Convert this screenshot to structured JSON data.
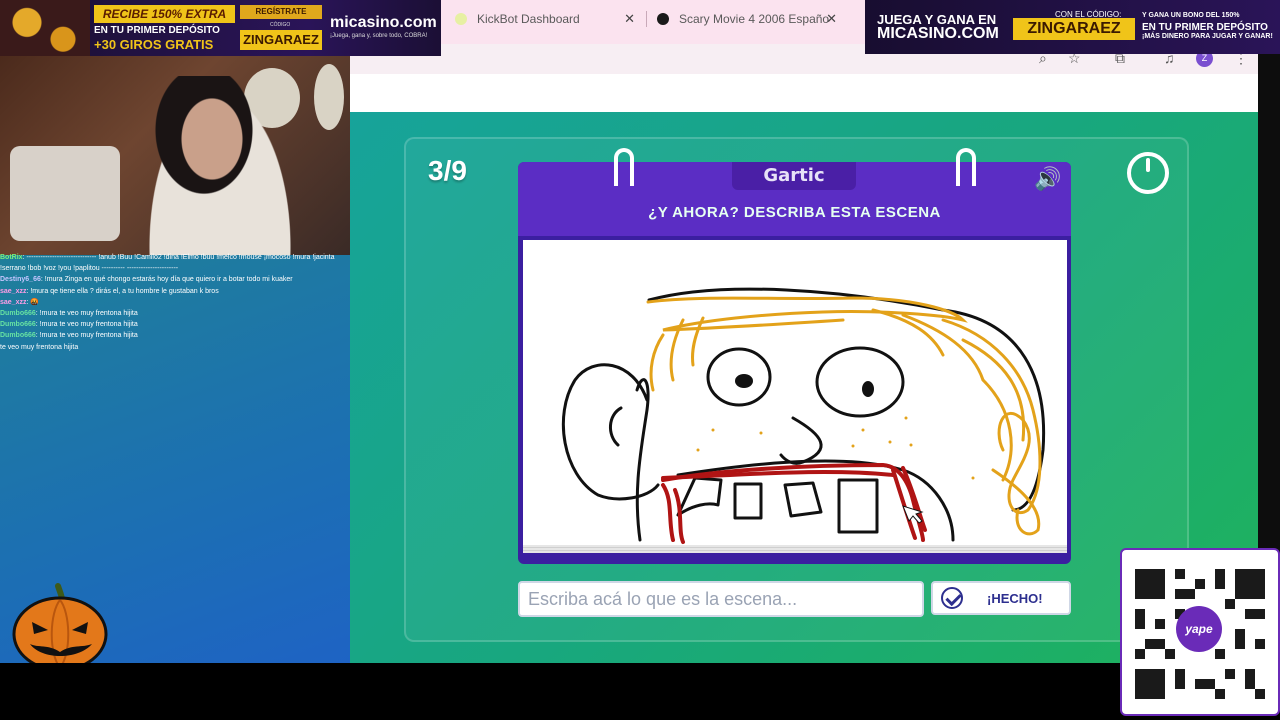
{
  "browser": {
    "tabs": [
      {
        "title": "KickBot Dashboard",
        "fav_color": "#e7f0a3"
      },
      {
        "title": "Scary Movie 4 2006 Españo",
        "fav_color": "#1a1a1a"
      }
    ],
    "profile_initial": "Z"
  },
  "game": {
    "round": "3/9",
    "brand": "Gartic",
    "instruction": "¿Y AHORA? DESCRIBA ESTA ESCENA",
    "input_placeholder": "Escriba acá lo que es la escena...",
    "done_label": "¡HECHO!",
    "colors": {
      "bg": "#17a39a",
      "header": "#5b2dc4",
      "book": "#3b1fa0",
      "instruction": "#e6fff2"
    }
  },
  "ads": {
    "left": {
      "offer_line1": "RECIBE 150% EXTRA",
      "offer_line2": "EN TU PRIMER DEPÓSITO",
      "offer_line3": "+30 GIROS GRATIS",
      "register": "REGÍSTRATE",
      "code_label": "CÓDIGO",
      "code": "ZINGARAEZ",
      "logo": "micasino.com",
      "tagline": "¡Juega, gana y, sobre todo, COBRA!"
    },
    "right": {
      "line1": "JUEGA Y GANA EN",
      "line2": "MICASINO.COM",
      "code_label": "CON EL CÓDIGO:",
      "code": "ZINGARAEZ",
      "line3": "Y GANA UN BONO DEL 150%",
      "line4": "EN TU PRIMER DEPÓSITO",
      "line5": "¡MÁS DINERO PARA JUGAR Y GANAR!"
    }
  },
  "chat": [
    {
      "user": "BotRix",
      "color": "#7cf07c",
      "text": ": ------------------------------ !anub !Buu !Camilo2 !dina !Elmo !buu !melco !mouse ¡mocoso !mura !jacinta !serrano !bob !voz !you !paplitou ---------- ----------------------"
    },
    {
      "user": "Destiny6_66",
      "color": "#c6c6ff",
      "text": ": !mura Zinga en qué chongo estarás hoy día que quiero ir a botar todo mi kuaker"
    },
    {
      "user": "sae_xzz",
      "color": "#ff9de6",
      "text": ": !mura qe tiene ella ? dirás el, a tu hombre le gustaban k bros"
    },
    {
      "user": "sae_xzz",
      "color": "#ff9de6",
      "text": ": 🤬"
    },
    {
      "user": "Dumbo666",
      "color": "#66e2a2",
      "text": ": !mura te veo muy frentona hijita"
    },
    {
      "user": "Dumbo666",
      "color": "#66e2a2",
      "text": ": !mura te veo muy frentona hijita"
    },
    {
      "user": "Dumbo666",
      "color": "#66e2a2",
      "text": ": !mura te veo muy frentona hijita"
    },
    {
      "user": "",
      "color": "#ffffff",
      "text": "te veo muy frentona hijita"
    }
  ],
  "qr": {
    "badge": "yape"
  }
}
